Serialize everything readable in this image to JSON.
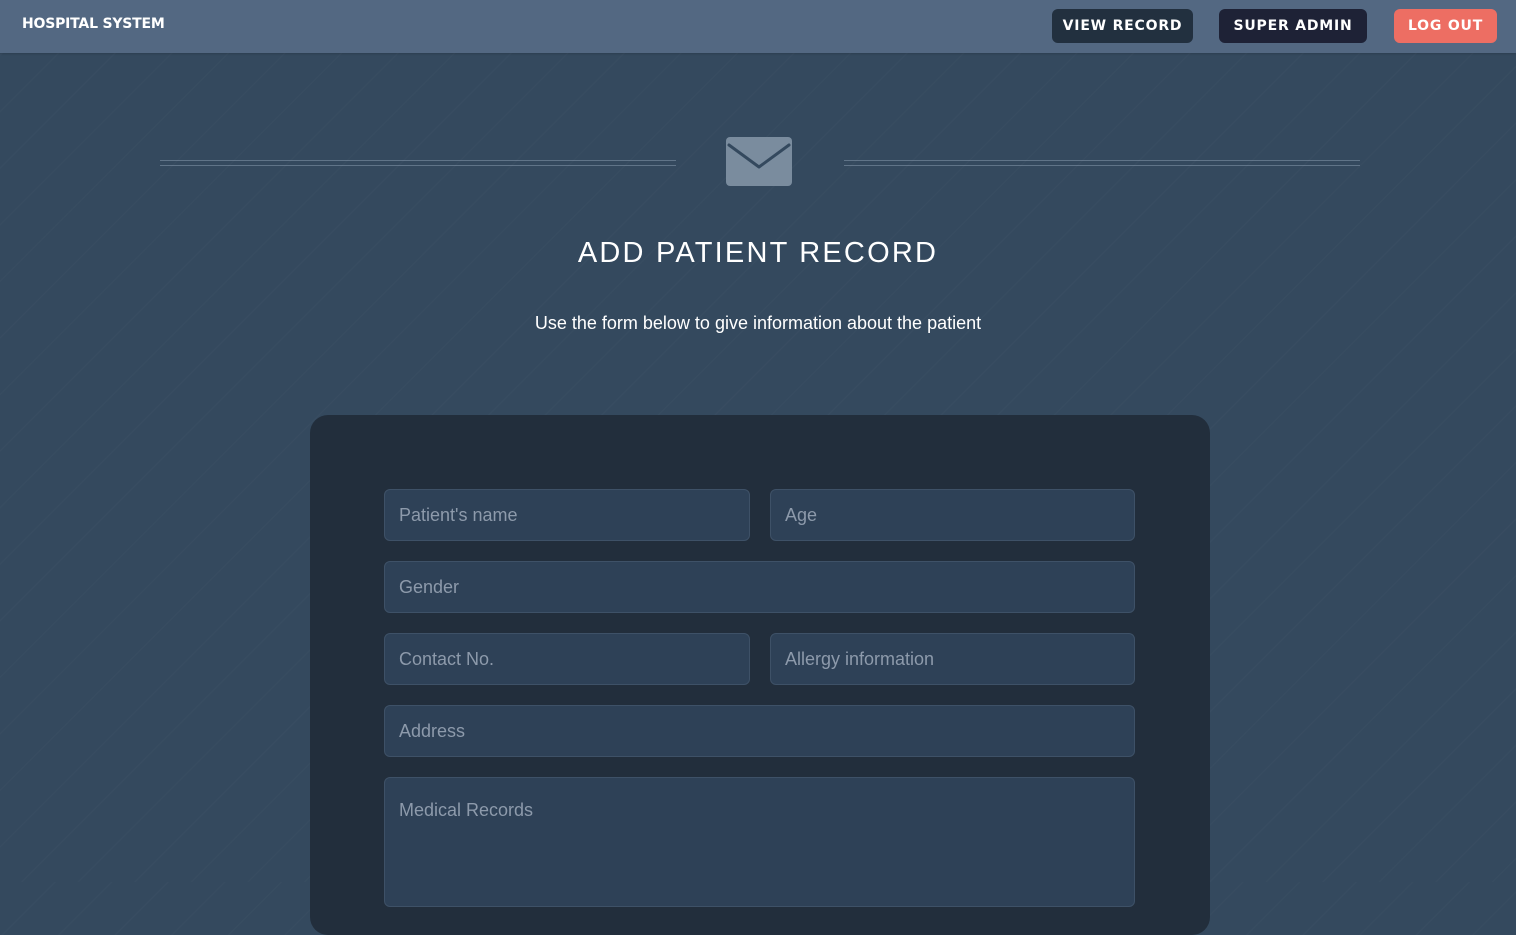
{
  "navbar": {
    "brand": "HOSPITAL SYSTEM",
    "buttons": {
      "view_record": "VIEW RECORD",
      "super_admin": "SUPER ADMIN",
      "log_out": "LOG OUT"
    }
  },
  "header": {
    "icon": "envelope-icon",
    "title": "ADD PATIENT RECORD",
    "subtitle": "Use the form below to give information about the patient"
  },
  "form": {
    "fields": {
      "patient_name": {
        "placeholder": "Patient's name",
        "value": ""
      },
      "age": {
        "placeholder": "Age",
        "value": ""
      },
      "gender": {
        "placeholder": "Gender",
        "value": ""
      },
      "contact_no": {
        "placeholder": "Contact No.",
        "value": ""
      },
      "allergy_information": {
        "placeholder": "Allergy information",
        "value": ""
      },
      "address": {
        "placeholder": "Address",
        "value": ""
      },
      "medical_records": {
        "placeholder": "Medical Records",
        "value": ""
      }
    }
  },
  "colors": {
    "background": "#34495e",
    "navbar": "#536882",
    "panel": "#222e3c",
    "field": "#2e4157",
    "logout_accent": "#ed6e63",
    "view_record_button": "#22303f",
    "super_admin_button": "#1e2236",
    "envelope_icon": "#7a8c9e"
  }
}
